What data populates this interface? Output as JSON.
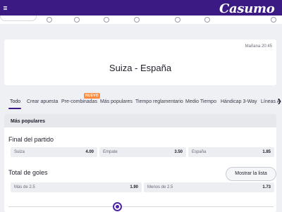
{
  "header": {
    "logo_text": "Casumo",
    "menu_icon": "hamburger-icon",
    "brand_color": "#3c1a83"
  },
  "match": {
    "kickoff": "Mañana 20:45",
    "title": "Suiza - España"
  },
  "tabs": [
    {
      "label": "Todo",
      "active": true
    },
    {
      "label": "Crear apuesta"
    },
    {
      "label": "Pre-combinadas",
      "badge": "NUEVO"
    },
    {
      "label": "Más populares"
    },
    {
      "label": "Tiempo reglamentario"
    },
    {
      "label": "Medio Tiempo"
    },
    {
      "label": "Hándicap 3-Way"
    },
    {
      "label": "Líneas A"
    }
  ],
  "section": {
    "title": "Más populares"
  },
  "markets": {
    "final": {
      "title": "Final del partido",
      "selections": [
        {
          "label": "Suiza",
          "odds": "4.00"
        },
        {
          "label": "Empate",
          "odds": "3.50"
        },
        {
          "label": "España",
          "odds": "1.85"
        }
      ]
    },
    "goals": {
      "title": "Total de goles",
      "show_list_label": "Mostrar la lista",
      "selections": [
        {
          "label": "Más de 2.5",
          "odds": "1.90"
        },
        {
          "label": "Menos de 2.5",
          "odds": "1.73"
        }
      ]
    }
  },
  "goal_line_slider": {
    "icon": "slider-knob",
    "accent_color": "#4d24a3"
  }
}
